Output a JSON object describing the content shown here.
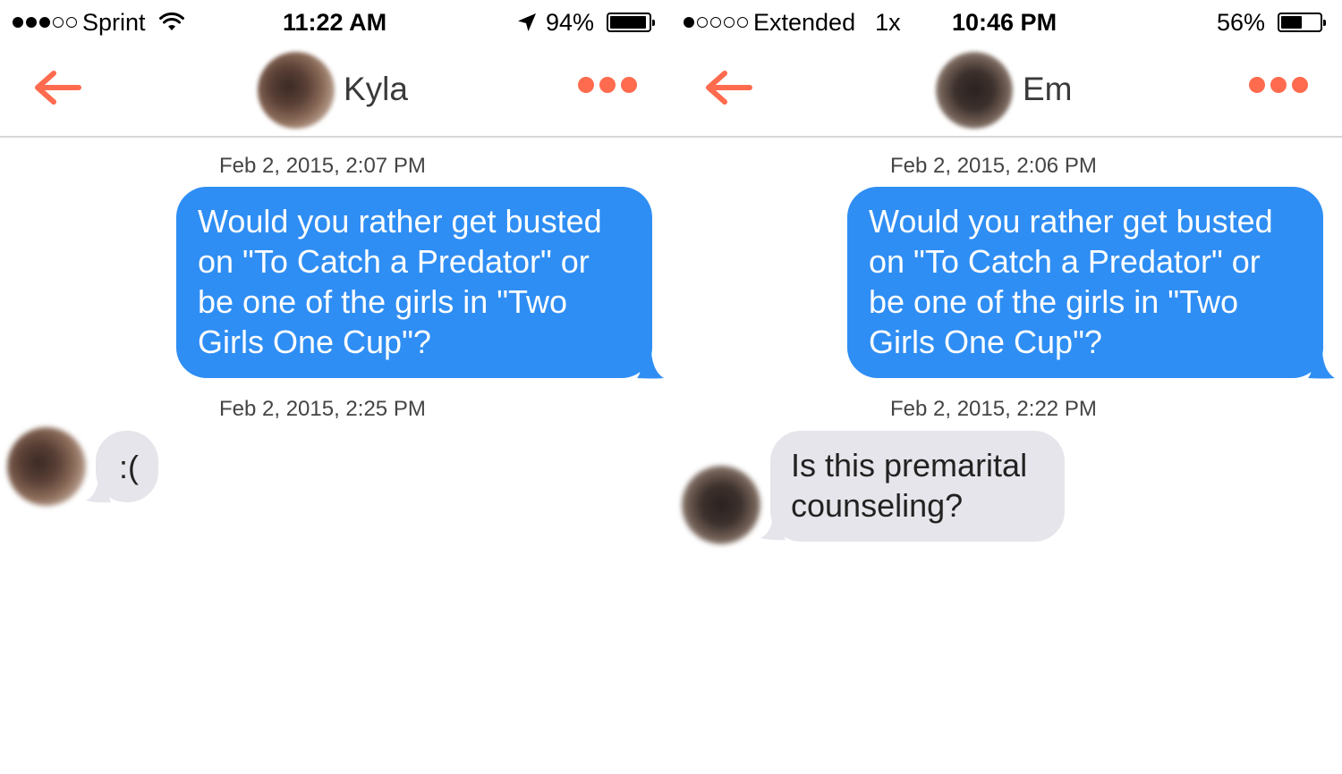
{
  "screens": [
    {
      "status": {
        "carrier": "Sprint",
        "time": "11:22 AM",
        "battery": "94%",
        "battery_level": 0.94,
        "signal_bars": 3
      },
      "contact": {
        "name": "Kyla"
      },
      "messages": [
        {
          "timestamp": "Feb 2, 2015, 2:07 PM",
          "direction": "outgoing",
          "text": "Would you rather get busted on \"To Catch a Predator\" or be one of the girls in \"Two Girls One Cup\"?"
        },
        {
          "timestamp": "Feb 2, 2015, 2:25 PM",
          "direction": "incoming",
          "text": ":("
        }
      ]
    },
    {
      "status": {
        "carrier": "Extended",
        "zoom": "1x",
        "time": "10:46 PM",
        "battery": "56%",
        "battery_level": 0.56,
        "signal_bars": 1
      },
      "contact": {
        "name": "Em"
      },
      "messages": [
        {
          "timestamp": "Feb 2, 2015, 2:06 PM",
          "direction": "outgoing",
          "text": "Would you rather get busted on \"To Catch a Predator\" or be one of the girls in \"Two Girls One Cup\"?"
        },
        {
          "timestamp": "Feb 2, 2015, 2:22 PM",
          "direction": "incoming",
          "text": "Is this premarital counseling?"
        }
      ]
    }
  ],
  "colors": {
    "accent": "#ff6b4e",
    "outgoing_bubble": "#2f8ef4",
    "incoming_bubble": "#e6e5eb"
  },
  "icons": [
    "back-arrow-icon",
    "more-dots-icon",
    "wifi-icon",
    "location-arrow-icon",
    "battery-icon"
  ]
}
